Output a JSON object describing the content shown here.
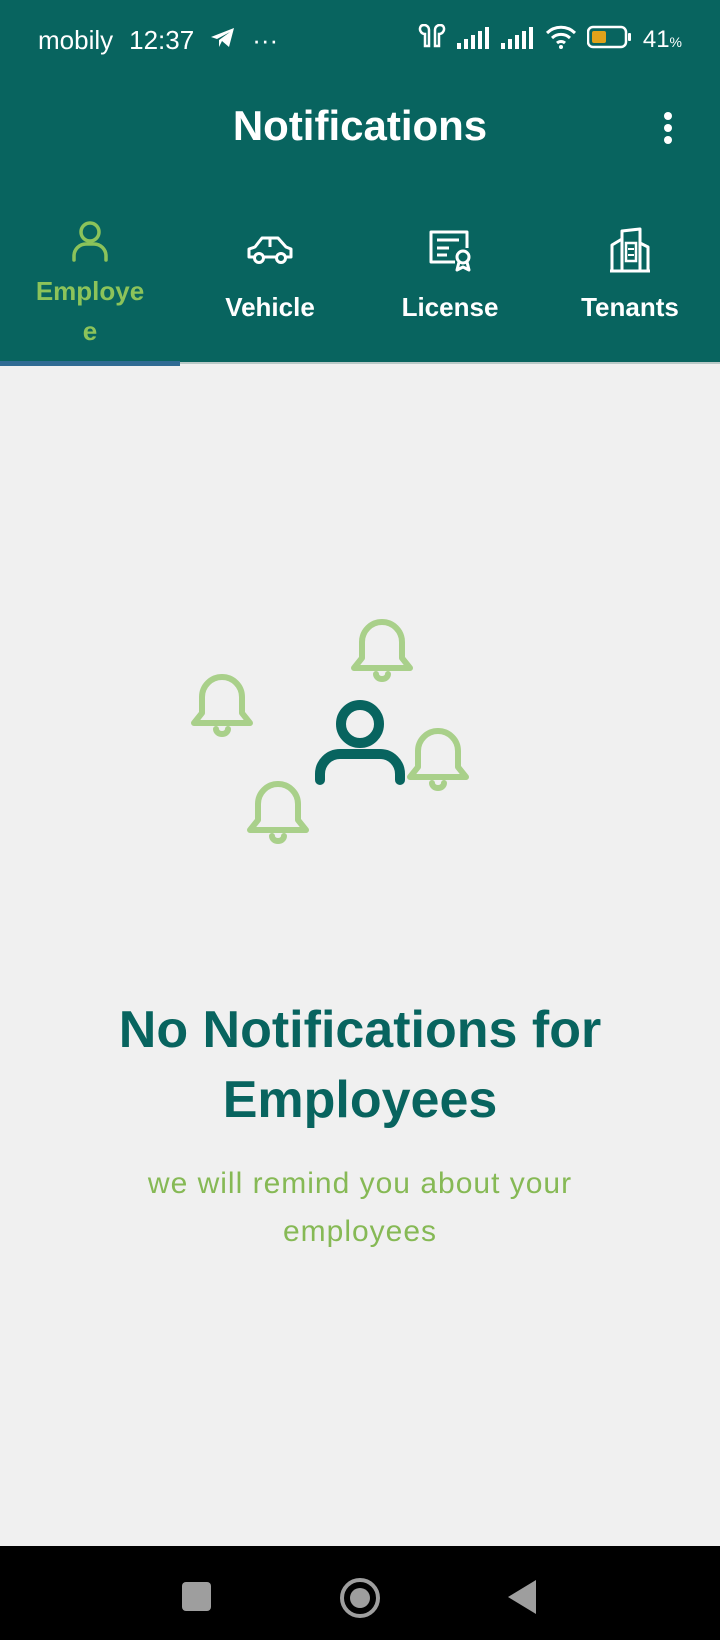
{
  "status_bar": {
    "carrier": "mobily",
    "time": "12:37",
    "overflow": "···",
    "battery_percent": "41",
    "battery_unit": "%",
    "battery_color": "#e0a21a"
  },
  "app_bar": {
    "title": "Notifications",
    "menu_icon": "more-vert-icon"
  },
  "tabs": [
    {
      "label": "Employe\ne",
      "icon": "person-icon",
      "active": true
    },
    {
      "label": "Vehicle",
      "icon": "car-icon",
      "active": false
    },
    {
      "label": "License",
      "icon": "certificate-icon",
      "active": false
    },
    {
      "label": "Tenants",
      "icon": "buildings-icon",
      "active": false
    }
  ],
  "empty_state": {
    "title": "No Notifications for Employees",
    "subtitle": "we will remind you about your employees",
    "illustration": "person-with-bells-icon"
  },
  "colors": {
    "primary": "#08645f",
    "accent": "#8cc35a",
    "background": "#f0f0f0",
    "indicator": "#2f6b93"
  },
  "nav_bar": {
    "buttons": [
      "recents",
      "home",
      "back"
    ]
  }
}
